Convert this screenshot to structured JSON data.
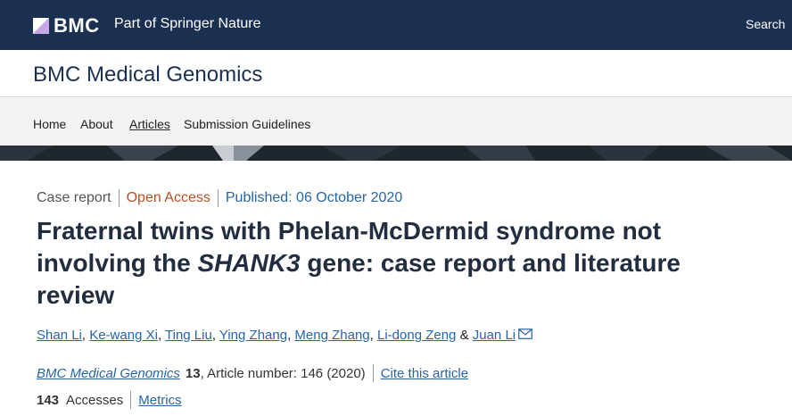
{
  "header": {
    "logo_text": "BMC",
    "tagline": "Part of Springer Nature",
    "search_label": "Search"
  },
  "journal": {
    "title": "BMC Medical Genomics"
  },
  "nav": {
    "items": [
      {
        "label": "Home"
      },
      {
        "label": "About"
      },
      {
        "label": "Articles"
      },
      {
        "label": "Submission Guidelines"
      }
    ]
  },
  "article": {
    "type": "Case report",
    "access": "Open Access",
    "published": "Published: 06 October 2020",
    "title_part1": "Fraternal twins with Phelan-McDermid syndrome not involving the ",
    "title_gene": "SHANK3",
    "title_part2": " gene: case report and literature review",
    "authors": [
      "Shan Li",
      "Ke-wang Xi",
      "Ting Liu",
      "Ying Zhang",
      "Meng Zhang",
      "Li-dong Zeng",
      "Juan Li"
    ],
    "author_sep": ", ",
    "author_and": " & ",
    "journal_name": "BMC Medical Genomics",
    "volume": "13",
    "article_number": ", Article number: 146 (2020)",
    "cite_label": "Cite this article",
    "accesses_count": "143",
    "accesses_label": "Accesses",
    "metrics_label": "Metrics"
  },
  "colors": {
    "topbar": "#1b3051",
    "link": "#2764a8",
    "open_access": "#b84f27",
    "title": "#222d3f"
  }
}
